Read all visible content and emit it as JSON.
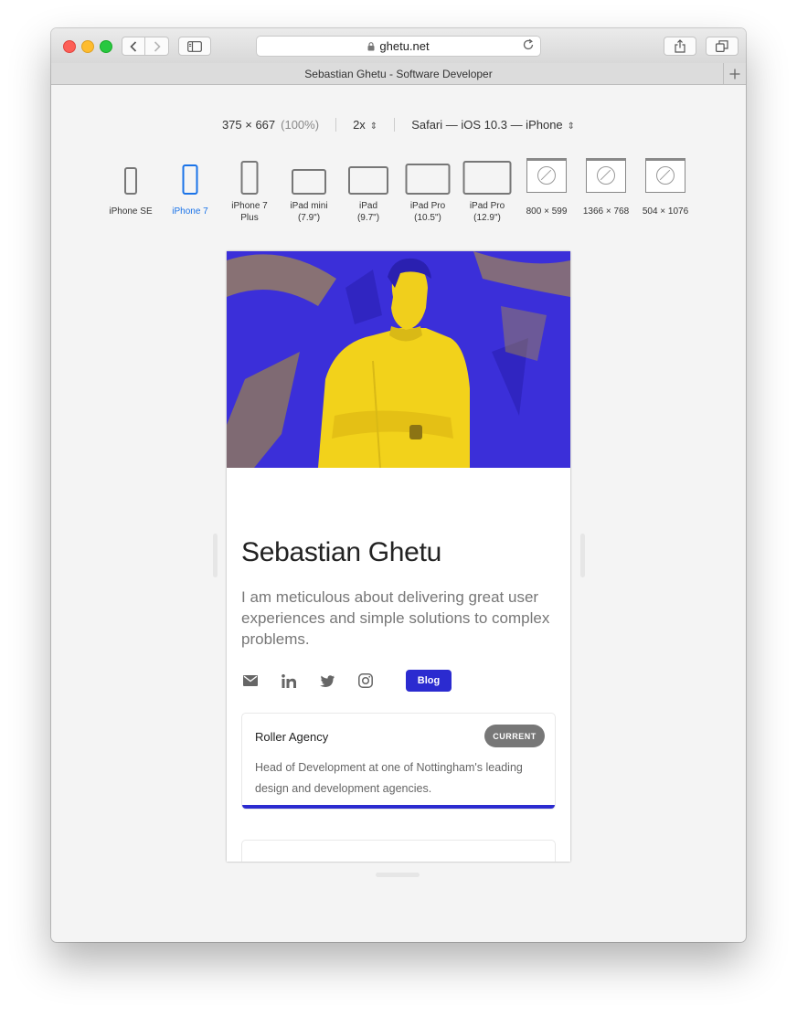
{
  "browser": {
    "url": "ghetu.net",
    "tab_title": "Sebastian Ghetu - Software Developer",
    "new_tab_icon": "plus-icon"
  },
  "responsive_bar": {
    "dimensions": "375 × 667",
    "zoom_percent": "(100%)",
    "pixel_ratio": "2x",
    "user_agent": "Safari — iOS 10.3 — iPhone"
  },
  "devices": [
    {
      "label": "iPhone SE",
      "active": false
    },
    {
      "label": "iPhone 7",
      "active": true
    },
    {
      "label": "iPhone 7\nPlus",
      "active": false
    },
    {
      "label": "iPad mini\n(7.9\")",
      "active": false
    },
    {
      "label": "iPad\n(9.7\")",
      "active": false
    },
    {
      "label": "iPad Pro\n(10.5\")",
      "active": false
    },
    {
      "label": "iPad Pro\n(12.9\")",
      "active": false
    },
    {
      "label": "800 × 599",
      "active": false
    },
    {
      "label": "1366 × 768",
      "active": false
    },
    {
      "label": "504 × 1076",
      "active": false
    }
  ],
  "profile": {
    "name": "Sebastian Ghetu",
    "bio": "I am meticulous about delivering great user experiences and simple solutions to complex problems.",
    "blog_label": "Blog",
    "accent_color": "#2b2bd0",
    "hero_colors": {
      "shadow": "#3b2fd9",
      "highlight": "#f2d21b"
    }
  },
  "experience": [
    {
      "company": "Roller Agency",
      "badge": "CURRENT",
      "description": "Head of Development at one of Nottingham's leading design and development agencies."
    }
  ]
}
